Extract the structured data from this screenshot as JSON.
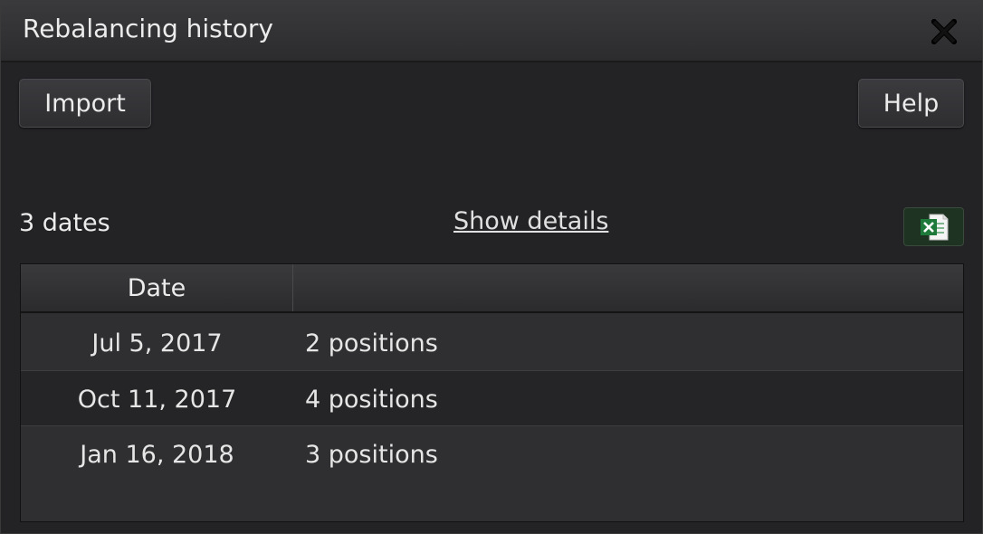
{
  "window": {
    "title": "Rebalancing history"
  },
  "toolbar": {
    "import_label": "Import",
    "help_label": "Help"
  },
  "summary": {
    "count_label": "3 dates",
    "show_details_label": "Show details",
    "export_icon": "excel-icon"
  },
  "table": {
    "columns": [
      "Date",
      ""
    ],
    "rows": [
      {
        "date": "Jul 5, 2017",
        "positions": "2 positions"
      },
      {
        "date": "Oct 11, 2017",
        "positions": "4 positions"
      },
      {
        "date": "Jan 16, 2018",
        "positions": "3 positions"
      }
    ]
  },
  "colors": {
    "background": "#232326",
    "excel_green": "#1d7a3a"
  }
}
